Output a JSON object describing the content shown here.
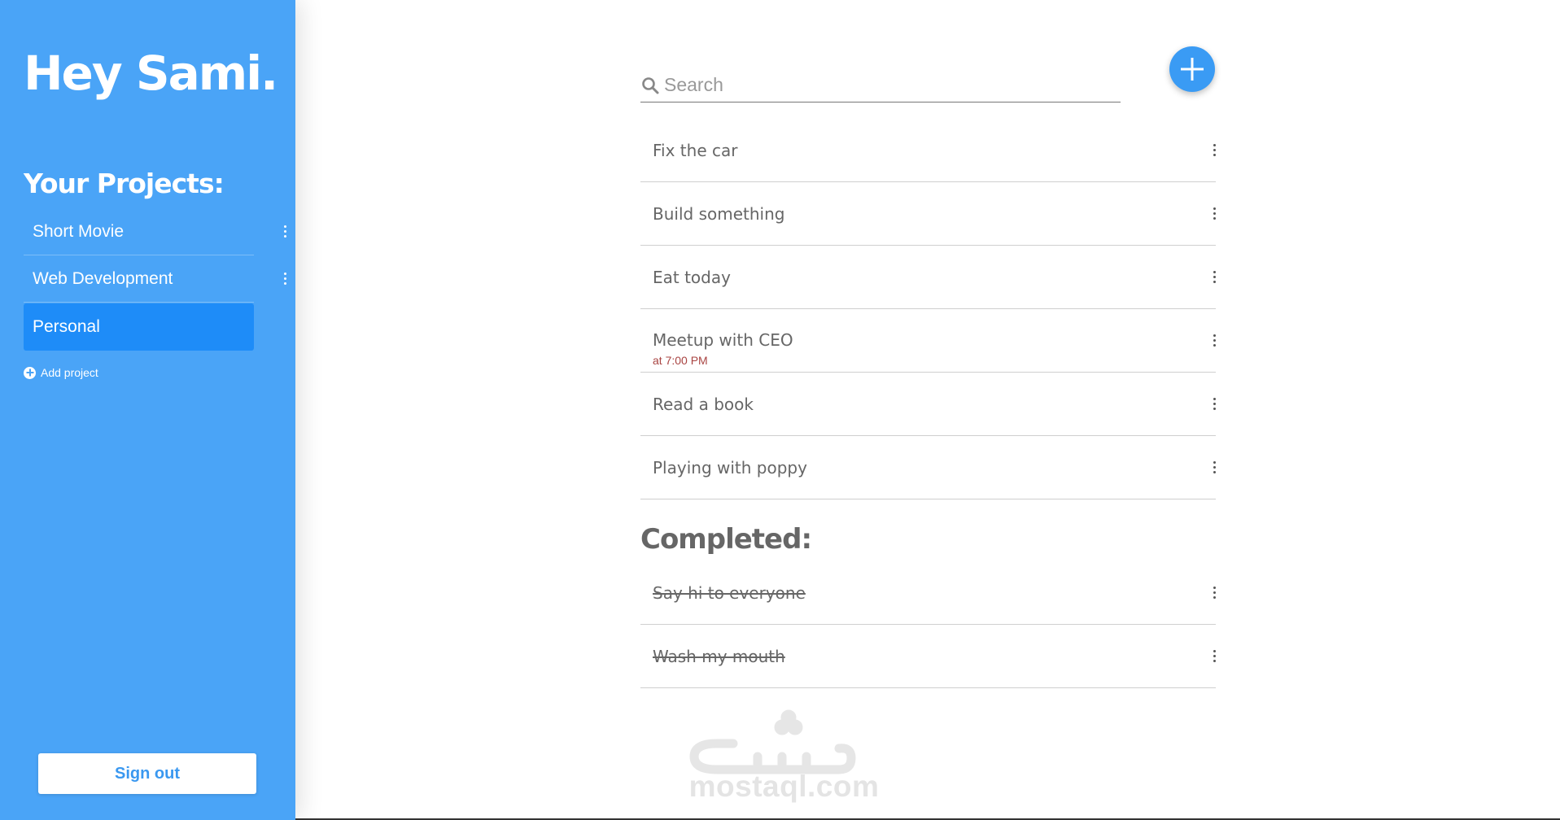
{
  "sidebar": {
    "greeting": "Hey Sami.",
    "projects_title": "Your Projects:",
    "projects": [
      {
        "label": "Short Movie"
      },
      {
        "label": "Web Development"
      },
      {
        "label": "Personal",
        "active": true
      }
    ],
    "add_project_label": "Add project",
    "sign_out_label": "Sign out"
  },
  "main": {
    "search": {
      "placeholder": "Search",
      "value": ""
    },
    "add_task_icon": "plus-icon",
    "tasks": [
      {
        "title": "Fix the car"
      },
      {
        "title": "Build something"
      },
      {
        "title": "Eat today"
      },
      {
        "title": "Meetup with CEO",
        "time": "at 7:00 PM"
      },
      {
        "title": "Read a book"
      },
      {
        "title": "Playing with poppy"
      }
    ],
    "completed_heading": "Completed:",
    "completed_tasks": [
      {
        "title": "Say hi to everyone"
      },
      {
        "title": "Wash my mouth"
      }
    ],
    "watermark_text": "mostaql.com"
  },
  "colors": {
    "sidebar_bg": "#4aa4f7",
    "active_project_bg": "#1e8cf8",
    "accent": "#3a9bf4",
    "task_time": "#a94442",
    "text": "#666666"
  }
}
